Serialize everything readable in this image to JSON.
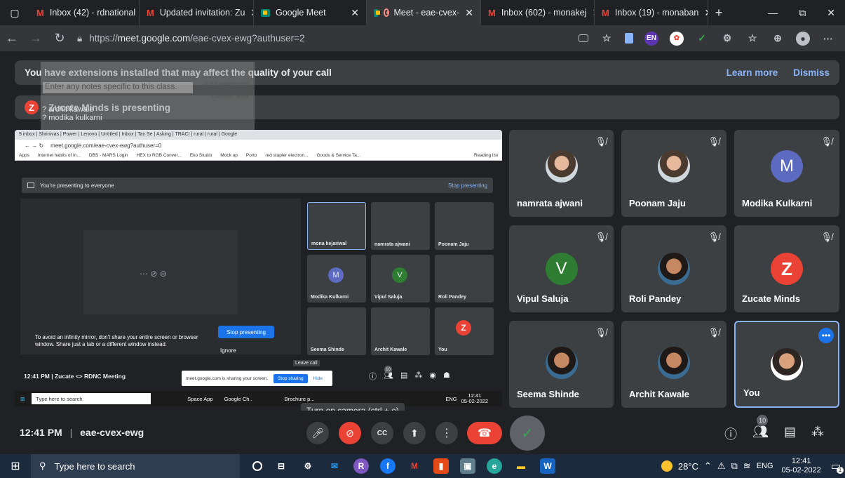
{
  "tabs": [
    {
      "label": "Inbox (42) - rdnational",
      "icon": "gmail-icon",
      "active": false
    },
    {
      "label": "Updated invitation: Zu",
      "icon": "gmail-icon",
      "active": false
    },
    {
      "label": "Google Meet",
      "icon": "meet-icon",
      "active": false
    },
    {
      "label": "Meet - eae-cvex-",
      "icon": "meet-icon",
      "active": true
    },
    {
      "label": "Inbox (602) - monakej",
      "icon": "gmail-icon",
      "active": false
    },
    {
      "label": "Inbox (19) - monaban",
      "icon": "gmail-icon",
      "active": false
    }
  ],
  "url": {
    "prefix": "https://",
    "host": "meet.google.com",
    "path": "/eae-cvex-ewg?authuser=2"
  },
  "extensions_banner": {
    "text": "You have extensions installed that may affect the quality of your call",
    "learn_more": "Learn more",
    "dismiss": "Dismiss"
  },
  "presenting_banner": {
    "text": "Zucate Minds is presenting"
  },
  "notes_overlay": {
    "placeholder": "Enter any notes specific to this class.",
    "participants": "# of 8 participants",
    "start": "Start: 12:34",
    "duration": "Duration: 6min",
    "names": [
      "archit kawale",
      "modika kulkarni"
    ]
  },
  "participants": [
    {
      "name": "namrata ajwani",
      "avatar": "photo"
    },
    {
      "name": "Poonam Jaju",
      "avatar": "photo"
    },
    {
      "name": "Modika Kulkarni",
      "avatar": "M",
      "color": "#5c6bc0"
    },
    {
      "name": "Vipul Saluja",
      "avatar": "V",
      "color": "#2e7d32"
    },
    {
      "name": "Roli Pandey",
      "avatar": "photo"
    },
    {
      "name": "Zucate Minds",
      "avatar": "Z",
      "color": "#ea4335"
    },
    {
      "name": "Seema Shinde",
      "avatar": "photo"
    },
    {
      "name": "Archit Kawale",
      "avatar": "photo"
    },
    {
      "name": "You",
      "avatar": "photo"
    }
  ],
  "share": {
    "tabs_text": "9 inbox | Shrinivas | Power | Lenovo | Untitled | Inbox | Tax Se | Asking | TRACI | rural | rural | Google",
    "url": "meet.google.com/eae-cvex-ewg?authuser=0",
    "bookmarks": [
      "Apps",
      "Internet habits of In...",
      "DBS - MARS Login",
      "HEX to RGB Conver...",
      "Eko Studio",
      "Mock up",
      "Porto",
      "red stapler electron...",
      "Goods & Service Ta...",
      "Reading list"
    ],
    "presenting_text": "You're presenting to everyone",
    "stop_presenting_link": "Stop presenting",
    "mirror_text": "To avoid an infinity mirror, don't share your entire screen or browser window. Share just a tab or a different window instead.",
    "stop_presenting_btn": "Stop presenting",
    "ignore": "Ignore",
    "leave_call": "Leave call",
    "meeting": "12:41 PM  |  Zucate <> RDNC Meeting",
    "sharing_bar": {
      "text": "meet.google.com is sharing your screen.",
      "stop": "Stop sharing",
      "hide": "Hide"
    },
    "tiles": [
      "mona kejariwal",
      "namrata ajwani",
      "Poonam Jaju",
      "Modika Kulkarni",
      "Vipul Saluja",
      "Roli Pandey",
      "Seema Shinde",
      "Archit Kawale",
      "You"
    ],
    "taskbar": {
      "search": "Type here to search",
      "items": [
        "Space App",
        "Google Ch..",
        "Brochure p..."
      ],
      "lang": "ENG",
      "time": "12:41",
      "date": "05-02-2022"
    },
    "participants_count": "10"
  },
  "tooltip": "Turn on camera (ctrl + e)",
  "controls": {
    "time": "12:41 PM",
    "code": "eae-cvex-ewg",
    "participants_count": "10"
  },
  "taskbar": {
    "search": "Type here to search",
    "weather": "28°C",
    "lang": "ENG",
    "time": "12:41",
    "date": "05-02-2022",
    "notif": "1"
  },
  "colors": {
    "hangup": "#ea4335",
    "accent": "#8ab4f8",
    "taskbar": "#1c2a3d"
  }
}
